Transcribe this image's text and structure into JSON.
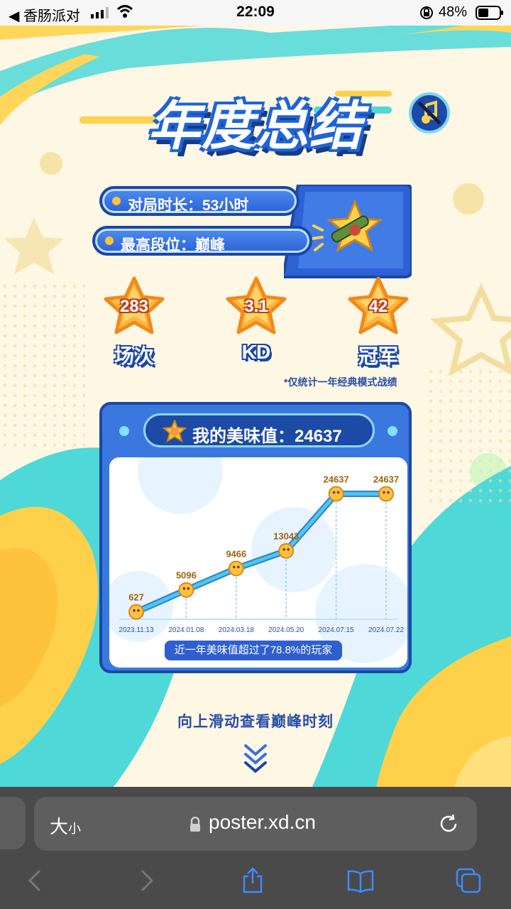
{
  "status_bar": {
    "back_app": "◀ 香肠派对",
    "time": "22:09",
    "battery": "48%"
  },
  "header": {
    "title": "年度总结"
  },
  "stats": {
    "play_time": "对局时长：53小时",
    "top_rank": "最高段位：巅峰"
  },
  "stars": [
    {
      "value": "283",
      "label": "场次"
    },
    {
      "value": "3.1",
      "label": "KD"
    },
    {
      "value": "42",
      "label": "冠军"
    }
  ],
  "note": "*仅统计一年经典模式战绩",
  "card": {
    "title": "我的美味值：24637",
    "rank_text": "近一年美味值超过了78.8%的玩家"
  },
  "chart_data": {
    "type": "line",
    "title": "我的美味值：24637",
    "categories": [
      "2023.11.13",
      "2024.01.08",
      "2024.03.18",
      "2024.05.20",
      "2024.07.15",
      "2024.07.22"
    ],
    "series": [
      {
        "values": [
          627,
          5096,
          9466,
          13043,
          24637,
          24637
        ]
      }
    ],
    "value_labels": [
      "627",
      "5096",
      "9466",
      "13043",
      "24637",
      "24637"
    ],
    "ylim": [
      0,
      26000
    ],
    "grid": false
  },
  "cta": "向上滑动查看巅峰时刻",
  "browser": {
    "text_size_big": "大",
    "text_size_small": "小",
    "url": "poster.xd.cn"
  },
  "colors": {
    "primary": "#2d62d6",
    "dark": "#1c47a6",
    "accent": "#ffc23d",
    "line": "#4fc6ea",
    "background": "#fdf7e4"
  },
  "icons": [
    "music-off-icon",
    "back-icon",
    "forward-icon",
    "share-icon",
    "bookmarks-icon",
    "tabs-icon",
    "reload-icon",
    "lock-icon",
    "chevron-down-icon"
  ]
}
